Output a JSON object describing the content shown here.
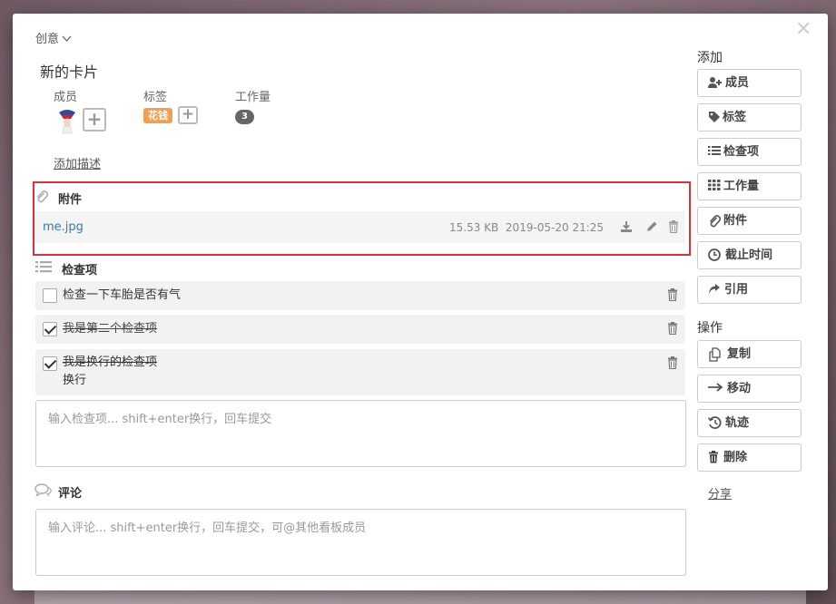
{
  "breadcrumb": {
    "label": "创意"
  },
  "card": {
    "title": "新的卡片"
  },
  "meta": {
    "members_label": "成员",
    "tags_label": "标签",
    "workload_label": "工作量",
    "tag_value": "花钱",
    "workload_value": "3"
  },
  "add_description": "添加描述",
  "attachments": {
    "heading": "附件",
    "items": [
      {
        "name": "me.jpg",
        "size": "15.53 KB",
        "date": "2019-05-20 21:25"
      }
    ]
  },
  "checklist": {
    "heading": "检查项",
    "items": [
      {
        "text": "检查一下车胎是否有气",
        "checked": false
      },
      {
        "text": "我是第二个检查项",
        "checked": true
      },
      {
        "text": "我是换行的检查项",
        "text2": "换行",
        "checked": true
      }
    ],
    "input_placeholder": "输入检查项... shift+enter换行，回车提交"
  },
  "comments": {
    "heading": "评论",
    "input_placeholder": "输入评论... shift+enter换行，回车提交，可@其他看板成员"
  },
  "sidebar": {
    "add_label": "添加",
    "add_buttons": [
      {
        "label": "成员",
        "icon": "add-user-icon"
      },
      {
        "label": "标签",
        "icon": "tag-icon"
      },
      {
        "label": "检查项",
        "icon": "list-icon"
      },
      {
        "label": "工作量",
        "icon": "grid-icon"
      },
      {
        "label": "附件",
        "icon": "paperclip-icon"
      },
      {
        "label": "截止时间",
        "icon": "clock-icon"
      },
      {
        "label": "引用",
        "icon": "share-arrow-icon"
      }
    ],
    "ops_label": "操作",
    "op_buttons": [
      {
        "label": "复制",
        "icon": "copy-icon"
      },
      {
        "label": "移动",
        "icon": "arrow-right-icon"
      },
      {
        "label": "轨迹",
        "icon": "history-icon"
      },
      {
        "label": "删除",
        "icon": "trash-icon"
      }
    ],
    "share_label": "分享"
  },
  "colors": {
    "link": "#2b7bc4",
    "tag": "#f0a050",
    "highlight": "#e0303a"
  }
}
